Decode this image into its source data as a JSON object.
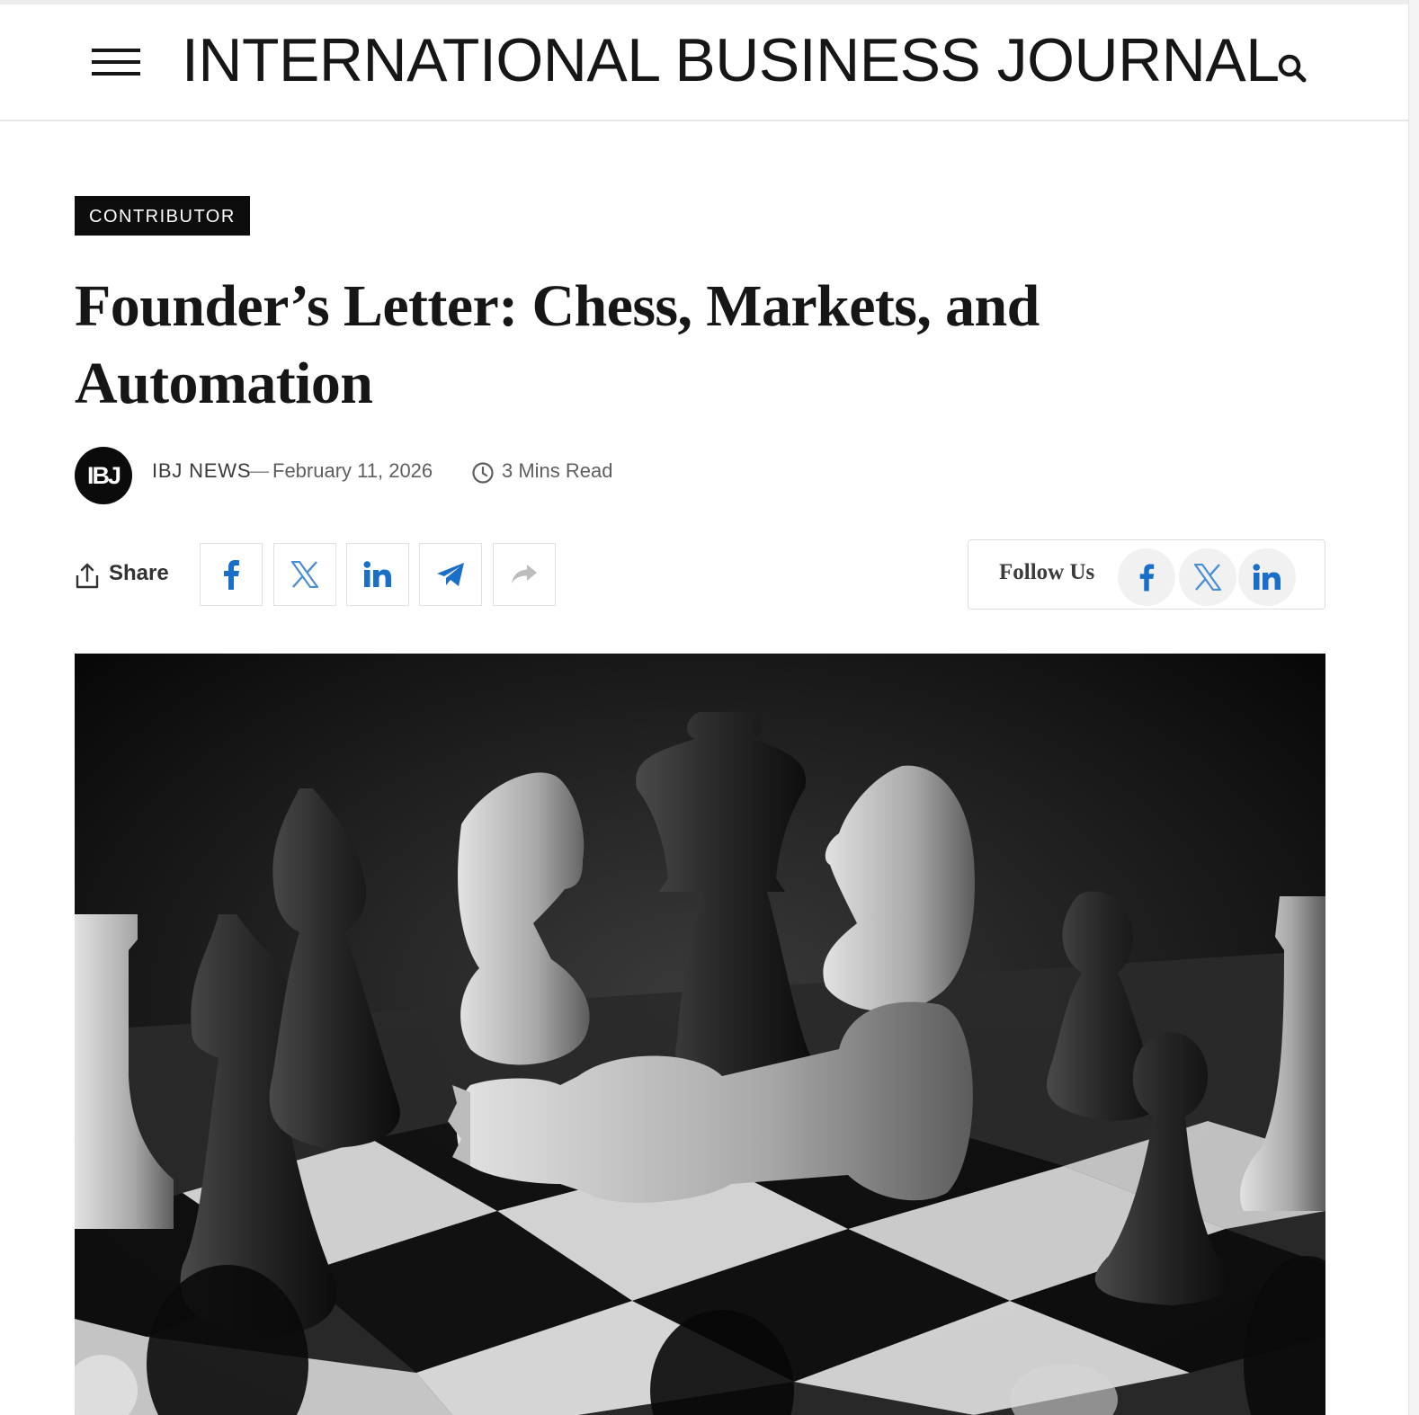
{
  "header": {
    "site_title": "INTERNATIONAL BUSINESS JOURNAL",
    "menu_icon": "hamburger-menu-icon",
    "search_icon": "search-icon"
  },
  "article": {
    "category": "CONTRIBUTOR",
    "title": "Founder’s Letter: Chess, Markets, and Automation",
    "author_avatar_text": "IBJ",
    "author": "IBJ NEWS",
    "separator": "—",
    "date": "February 11, 2026",
    "read_time": "3 Mins Read"
  },
  "share": {
    "label": "Share",
    "buttons": [
      {
        "icon": "facebook-icon",
        "color": "#1a6fc9"
      },
      {
        "icon": "x-icon",
        "color": "#4a8fd6"
      },
      {
        "icon": "linkedin-icon",
        "color": "#1a6fc9"
      },
      {
        "icon": "telegram-icon",
        "color": "#1a6fc9"
      },
      {
        "icon": "forward-icon",
        "color": "#bdbdbd"
      }
    ]
  },
  "follow": {
    "label": "Follow Us",
    "buttons": [
      {
        "icon": "facebook-icon",
        "color": "#1a6fc9"
      },
      {
        "icon": "x-icon",
        "color": "#4a8fd6"
      },
      {
        "icon": "linkedin-icon",
        "color": "#1a6fc9"
      }
    ]
  },
  "hero_image": {
    "subject": "black-and-white chess board with fallen king"
  }
}
